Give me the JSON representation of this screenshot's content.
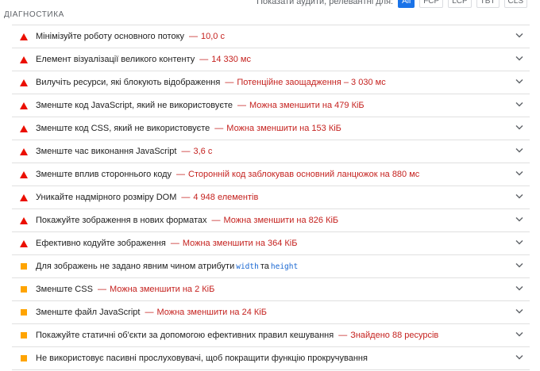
{
  "filter": {
    "label": "Показати аудити, релевантні для:",
    "chips": [
      "All",
      "FCP",
      "LCP",
      "TBT",
      "CLS"
    ],
    "active": 0
  },
  "section": {
    "title": "ДІАГНОСТИКА"
  },
  "colors": {
    "fail": "#eb0f00",
    "average": "#ffa400",
    "value": "#c5221f"
  },
  "audits": [
    {
      "severity": "fail",
      "title": "Мінімізуйте роботу основного потоку",
      "value": "10,0 с"
    },
    {
      "severity": "fail",
      "title": "Елемент візуалізації великого контенту",
      "value": "14 330 мс"
    },
    {
      "severity": "fail",
      "title": "Вилучіть ресурси, які блокують відображення",
      "value": "Потенційне заощадження – 3 030 мс"
    },
    {
      "severity": "fail",
      "title": "Зменште код JavaScript, який не використовуєте",
      "value": "Можна зменшити на 479 КіБ"
    },
    {
      "severity": "fail",
      "title": "Зменште код CSS, який не використовуєте",
      "value": "Можна зменшити на 153 КіБ"
    },
    {
      "severity": "fail",
      "title": "Зменште час виконання JavaScript",
      "value": "3,6 с"
    },
    {
      "severity": "fail",
      "title": "Зменште вплив стороннього коду",
      "value": "Сторонній код заблокував основний ланцюжок на 880 мс"
    },
    {
      "severity": "fail",
      "title": "Уникайте надмірного розміру DOM",
      "value": "4 948 елементів"
    },
    {
      "severity": "fail",
      "title": "Покажуйте зображення в нових форматах",
      "value": "Можна зменшити на 826 КіБ"
    },
    {
      "severity": "fail",
      "title": "Ефективно кодуйте зображення",
      "value": "Можна зменшити на 364 КіБ"
    },
    {
      "severity": "average",
      "title": "Для зображень не задано явним чином атрибути",
      "code1": "width",
      "mid": "та",
      "code2": "height"
    },
    {
      "severity": "average",
      "title": "Зменште CSS",
      "value": "Можна зменшити на 2 КіБ"
    },
    {
      "severity": "average",
      "title": "Зменште файл JavaScript",
      "value": "Можна зменшити на 24 КіБ"
    },
    {
      "severity": "average",
      "title": "Покажуйте статичні об'єкти за допомогою ефективних правил кешування",
      "value": "Знайдено 88 ресурсів"
    },
    {
      "severity": "average",
      "title": "Не використовує пасивні прослуховувачі, щоб покращити функцію прокручування"
    }
  ]
}
